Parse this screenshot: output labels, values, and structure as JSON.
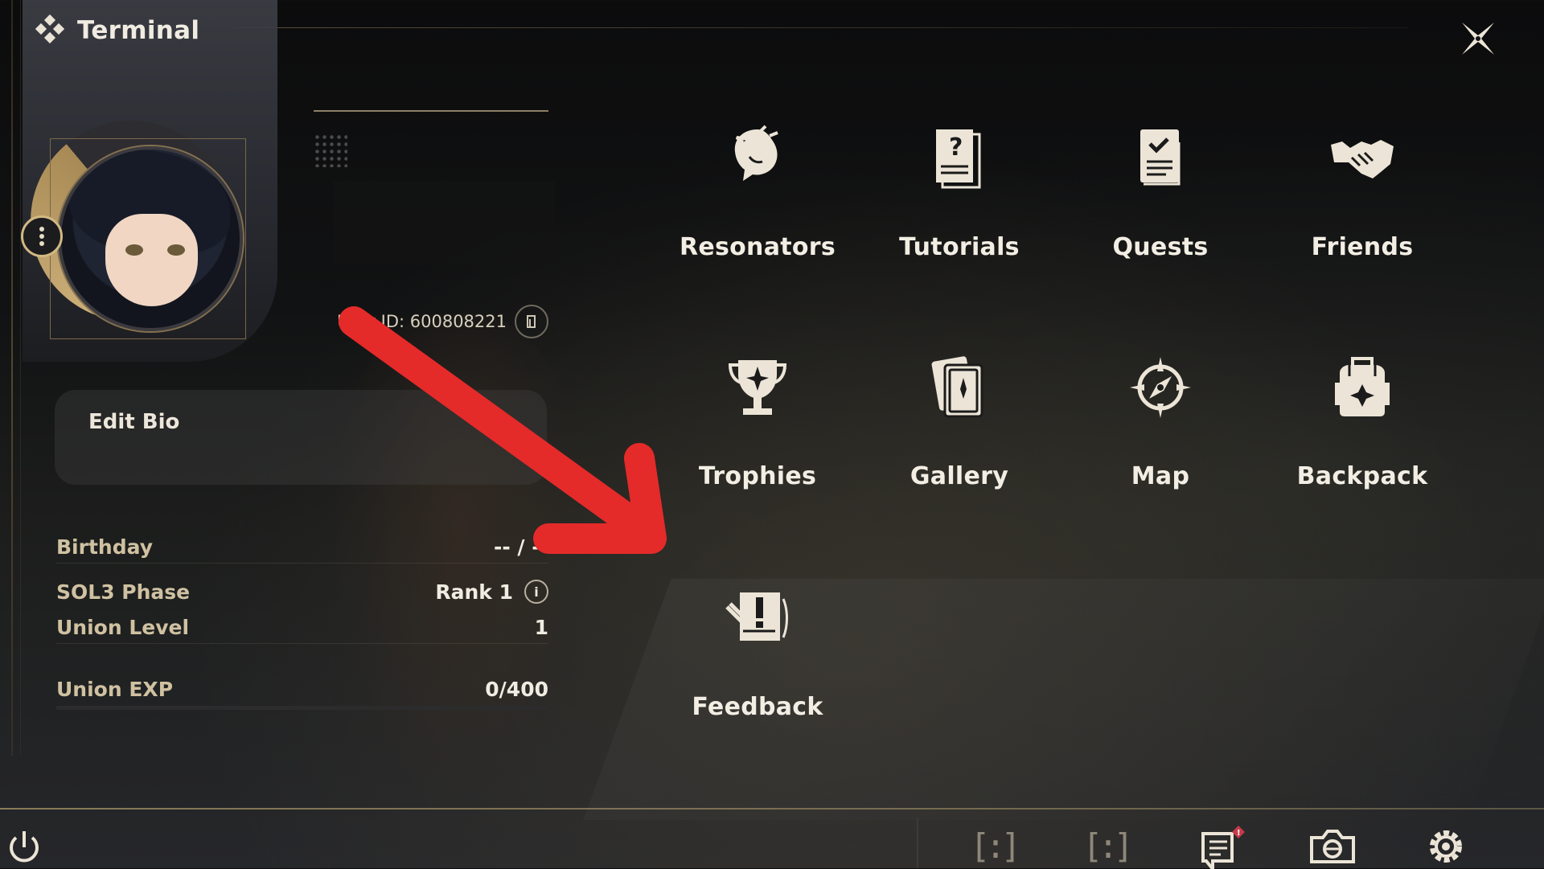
{
  "header": {
    "title": "Terminal"
  },
  "profile": {
    "user_id_label": "User ID: 600808221",
    "bio_label": "Edit Bio",
    "stats": [
      {
        "label": "Birthday",
        "value": "-- / --"
      },
      {
        "label": "SOL3 Phase",
        "value": "Rank 1"
      },
      {
        "label": "Union Level",
        "value": "1"
      },
      {
        "label": "Union EXP",
        "value": "0/400"
      }
    ],
    "union_exp_progress": 0
  },
  "menu": {
    "items": [
      {
        "label": "Resonators",
        "icon": "resonator-head-icon"
      },
      {
        "label": "Tutorials",
        "icon": "tutorial-book-icon"
      },
      {
        "label": "Quests",
        "icon": "quest-checklist-icon"
      },
      {
        "label": "Friends",
        "icon": "handshake-icon"
      },
      {
        "label": "Trophies",
        "icon": "trophy-icon"
      },
      {
        "label": "Gallery",
        "icon": "gallery-card-icon"
      },
      {
        "label": "Map",
        "icon": "compass-icon"
      },
      {
        "label": "Backpack",
        "icon": "backpack-icon"
      },
      {
        "label": "Feedback",
        "icon": "feedback-icon"
      }
    ]
  },
  "bottom_bar": {
    "icons": [
      "power-icon",
      "bracket-slot-icon",
      "bracket-slot-icon",
      "announcement-icon",
      "camera-icon",
      "settings-gear-icon"
    ],
    "announcement_badge": "!"
  },
  "colors": {
    "accent_gold": "#c9ae74",
    "arrow_red": "#e52a2a",
    "text": "#f1ece2"
  }
}
